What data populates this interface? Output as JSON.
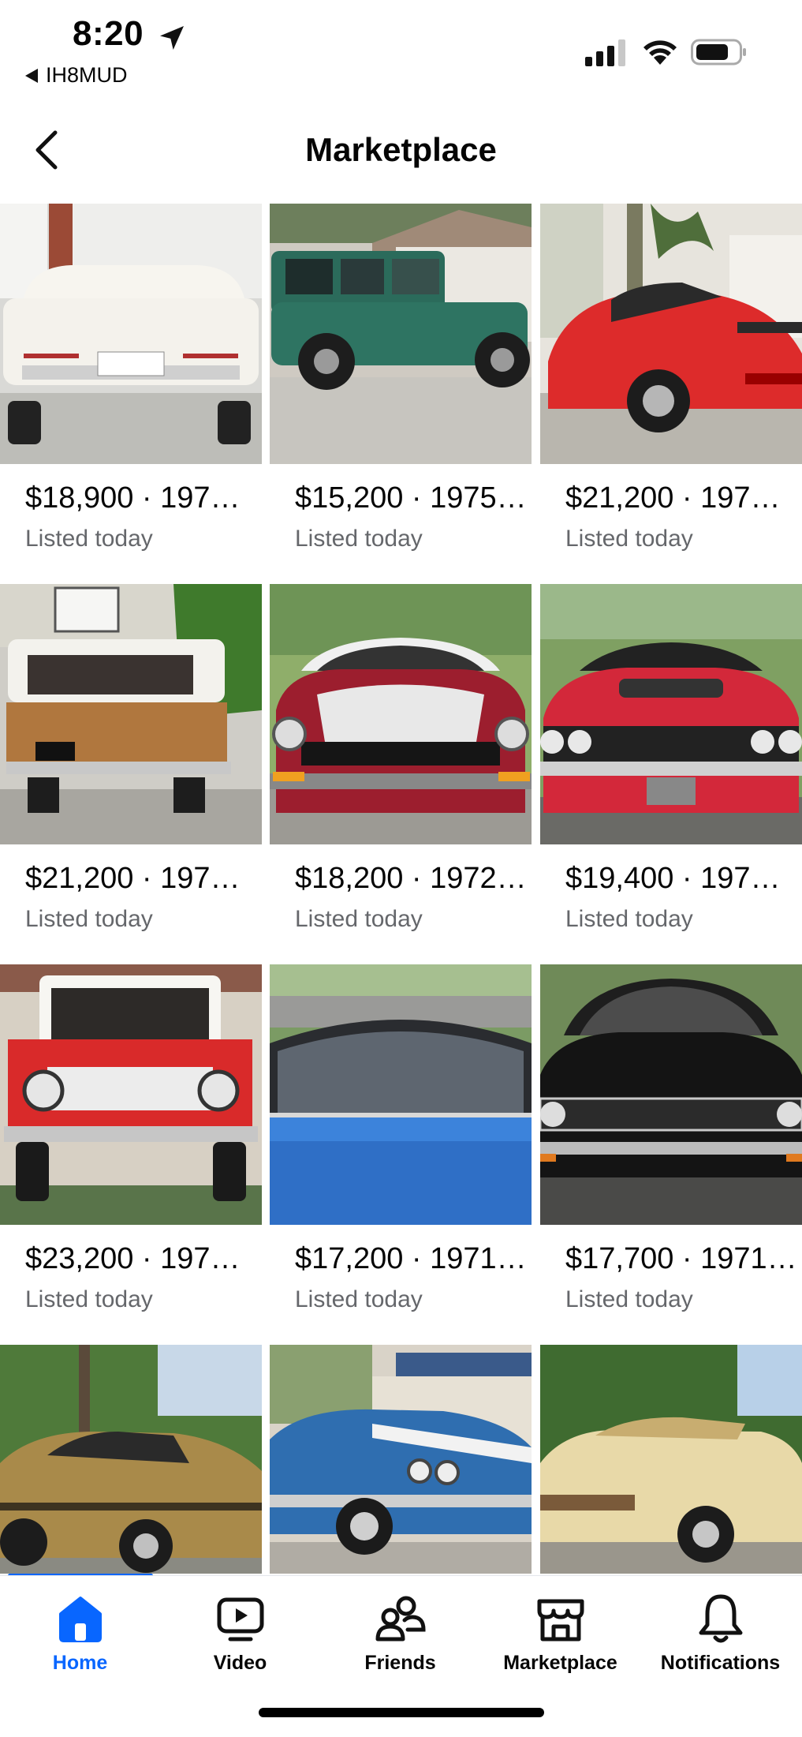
{
  "status_bar": {
    "time": "8:20",
    "back_app": "IH8MUD"
  },
  "header": {
    "title": "Marketplace"
  },
  "listings": [
    {
      "price": "$18,900 · 197…",
      "listed": "Listed today",
      "photo": "white cadillac convertible rear view"
    },
    {
      "price": "$15,200 · 1975…",
      "listed": "Listed today",
      "photo": "green toyota land cruiser side view"
    },
    {
      "price": "$21,200 · 197…",
      "listed": "Listed today",
      "photo": "red porsche targa"
    },
    {
      "price": "$21,200 · 197…",
      "listed": "Listed today",
      "photo": "white and brown ford bronco rear view"
    },
    {
      "price": "$18,200 · 1972…",
      "listed": "Listed today",
      "photo": "red and silver datsun z front view"
    },
    {
      "price": "$19,400 · 197…",
      "listed": "Listed today",
      "photo": "red plymouth gtx front view"
    },
    {
      "price": "$23,200 · 197…",
      "listed": "Listed today",
      "photo": "red ford bronco front view"
    },
    {
      "price": "$17,200 · 1971…",
      "listed": "Listed today",
      "photo": "blue car roof closeup"
    },
    {
      "price": "$17,700 · 1971…",
      "listed": "Listed today",
      "photo": "black chevy nova ss front view"
    },
    {
      "price": "",
      "listed": "",
      "photo": "gold oldsmobile 442"
    },
    {
      "price": "",
      "listed": "",
      "photo": "blue chevelle ss with white stripes"
    },
    {
      "price": "",
      "listed": "",
      "photo": "tan convertible rear three quarter"
    }
  ],
  "nav": {
    "items": [
      {
        "label": "Home",
        "icon": "home-icon",
        "active": true
      },
      {
        "label": "Video",
        "icon": "video-icon",
        "active": false
      },
      {
        "label": "Friends",
        "icon": "friends-icon",
        "active": false
      },
      {
        "label": "Marketplace",
        "icon": "marketplace-icon",
        "active": false
      },
      {
        "label": "Notifications",
        "icon": "bell-icon",
        "active": false
      }
    ]
  },
  "colors": {
    "accent": "#0866ff",
    "secondary_text": "#65676b"
  }
}
